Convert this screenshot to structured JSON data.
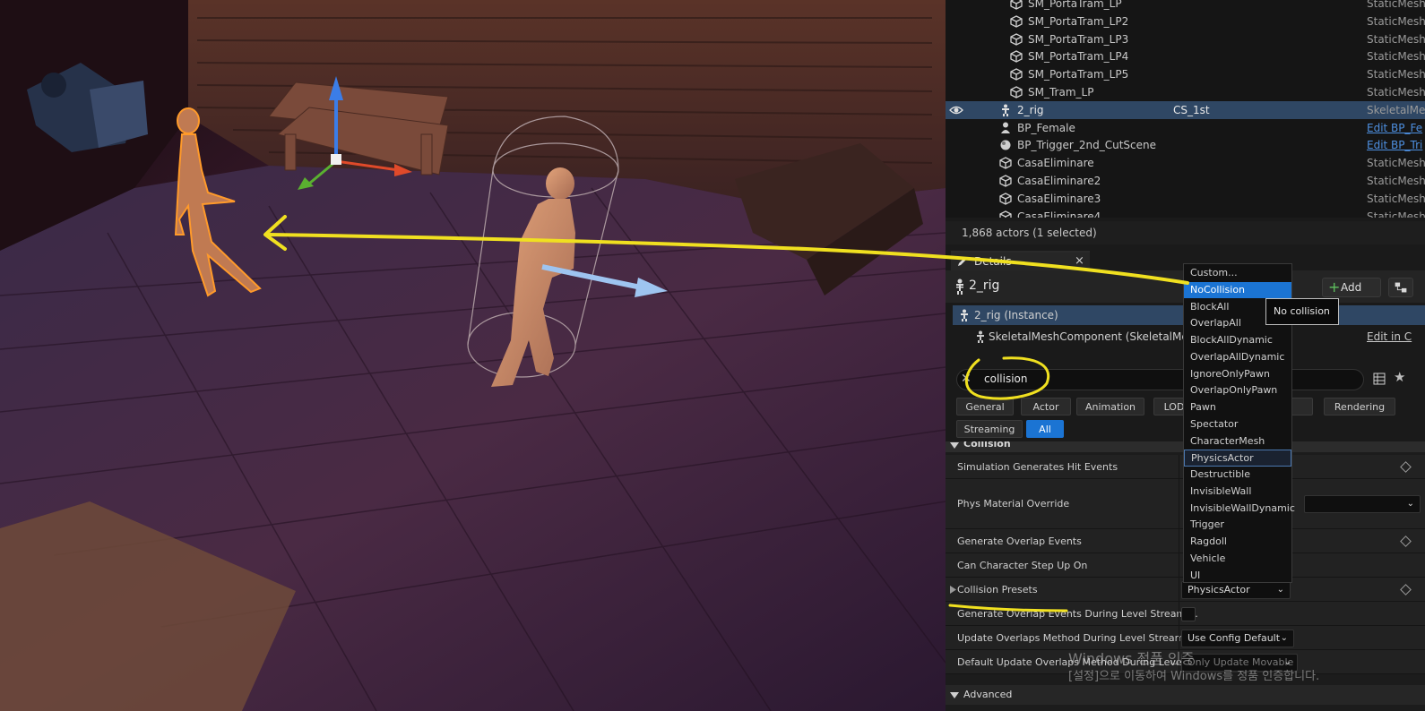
{
  "outliner": {
    "rows": [
      {
        "name": "SM_PortaTram_LP",
        "col2": "",
        "type": "StaticMesh",
        "icon": "static-mesh-icon",
        "indent": 2,
        "selected": false,
        "link": false
      },
      {
        "name": "SM_PortaTram_LP2",
        "col2": "",
        "type": "StaticMesh",
        "icon": "static-mesh-icon",
        "indent": 2,
        "selected": false,
        "link": false
      },
      {
        "name": "SM_PortaTram_LP3",
        "col2": "",
        "type": "StaticMesh",
        "icon": "static-mesh-icon",
        "indent": 2,
        "selected": false,
        "link": false
      },
      {
        "name": "SM_PortaTram_LP4",
        "col2": "",
        "type": "StaticMesh",
        "icon": "static-mesh-icon",
        "indent": 2,
        "selected": false,
        "link": false
      },
      {
        "name": "SM_PortaTram_LP5",
        "col2": "",
        "type": "StaticMesh",
        "icon": "static-mesh-icon",
        "indent": 2,
        "selected": false,
        "link": false
      },
      {
        "name": "SM_Tram_LP",
        "col2": "",
        "type": "StaticMesh",
        "icon": "static-mesh-icon",
        "indent": 2,
        "selected": false,
        "link": false
      },
      {
        "name": "2_rig",
        "col2": "CS_1st",
        "type": "SkeletalMe",
        "icon": "skeletal-mesh-icon",
        "indent": 1,
        "selected": true,
        "link": false
      },
      {
        "name": "BP_Female",
        "col2": "",
        "type": "Edit BP_Fe",
        "icon": "blueprint-pawn-icon",
        "indent": 1,
        "selected": false,
        "link": true
      },
      {
        "name": "BP_Trigger_2nd_CutScene",
        "col2": "",
        "type": "Edit BP_Tri",
        "icon": "blueprint-trigger-icon",
        "indent": 1,
        "selected": false,
        "link": true
      },
      {
        "name": "CasaEliminare",
        "col2": "",
        "type": "StaticMesh",
        "icon": "static-mesh-icon",
        "indent": 1,
        "selected": false,
        "link": false
      },
      {
        "name": "CasaEliminare2",
        "col2": "",
        "type": "StaticMesh",
        "icon": "static-mesh-icon",
        "indent": 1,
        "selected": false,
        "link": false
      },
      {
        "name": "CasaEliminare3",
        "col2": "",
        "type": "StaticMesh",
        "icon": "static-mesh-icon",
        "indent": 1,
        "selected": false,
        "link": false
      },
      {
        "name": "CasaEliminare4",
        "col2": "",
        "type": "StaticMesh",
        "icon": "static-mesh-icon",
        "indent": 1,
        "selected": false,
        "link": false
      }
    ],
    "actor_count": "1,868 actors (1 selected)"
  },
  "details": {
    "tab_label": "Details",
    "tab_close": "×",
    "actor_name": "2_rig",
    "add_label": "Add",
    "add_plus": "+",
    "instance_label": "2_rig (Instance)",
    "component_label": "SkeletalMeshComponent (SkeletalMes",
    "edit_link": "Edit in C",
    "search_value": "collision",
    "search_clear": "✕",
    "star": "★",
    "filters_row1": [
      {
        "label": "General",
        "active": false
      },
      {
        "label": "Actor",
        "active": false
      },
      {
        "label": "Animation",
        "active": false
      },
      {
        "label": "LOD",
        "active": false
      },
      {
        "label": "s",
        "active": false
      },
      {
        "label": "Rendering",
        "active": false
      }
    ],
    "filters_row2": [
      {
        "label": "Streaming",
        "active": false
      },
      {
        "label": "All",
        "active": true
      }
    ],
    "category": "Collision",
    "category_bottom": "Advanced",
    "properties": [
      {
        "label": "Simulation Generates Hit Events",
        "control": "none"
      },
      {
        "label": "Phys Material Override",
        "control": "none"
      },
      {
        "label": "Generate Overlap Events",
        "control": "none"
      },
      {
        "label": "Can Character Step Up On",
        "control": "none"
      },
      {
        "label": "Collision Presets",
        "control": "combo",
        "value": "PhysicsActor"
      },
      {
        "label": "Generate Overlap Events During Level Streami...",
        "control": "checkbox"
      },
      {
        "label": "Update Overlaps Method During Level Streami...",
        "control": "combo",
        "value": "Use Config Default"
      },
      {
        "label": "Default Update Overlaps Method During Level...",
        "control": "combo",
        "value": "Only Update Movable",
        "disabled": true
      }
    ]
  },
  "dropdown": {
    "items": [
      "Custom...",
      "NoCollision",
      "BlockAll",
      "OverlapAll",
      "BlockAllDynamic",
      "OverlapAllDynamic",
      "IgnoreOnlyPawn",
      "OverlapOnlyPawn",
      "Pawn",
      "Spectator",
      "CharacterMesh",
      "PhysicsActor",
      "Destructible",
      "InvisibleWall",
      "InvisibleWallDynamic",
      "Trigger",
      "Ragdoll",
      "Vehicle",
      "UI"
    ],
    "highlighted": "NoCollision",
    "current": "PhysicsActor",
    "tooltip": "No collision"
  },
  "watermark": {
    "line1": "Windows 정품 인증",
    "line2": "[설정]으로 이동하여 Windows를 정품 인증합니다."
  },
  "colors": {
    "accent": "#1b74d3",
    "selection": "#2f4764",
    "annotation": "#f0e020",
    "highlight_outline": "#ff9a2a"
  }
}
